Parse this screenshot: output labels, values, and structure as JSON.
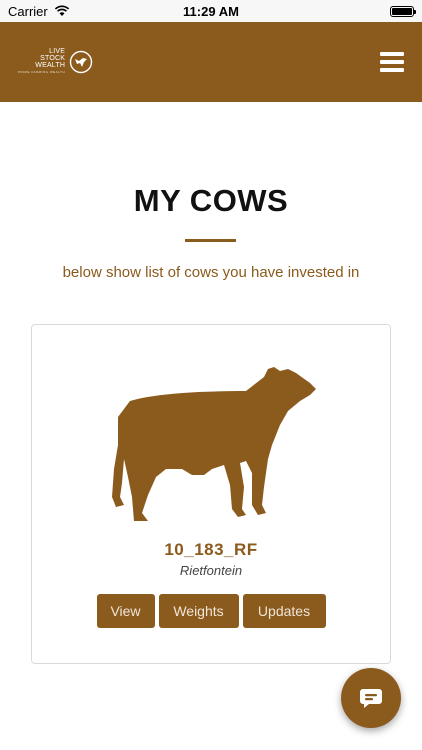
{
  "status_bar": {
    "carrier": "Carrier",
    "time": "11:29 AM"
  },
  "header": {
    "logo": {
      "line1": "LIVE",
      "line2": "STOCK",
      "line3": "WEALTH",
      "tagline": "PRIME FARMING WEALTH"
    },
    "menu_icon": "hamburger-menu-icon"
  },
  "page": {
    "title": "MY COWS",
    "subtitle": "below show list of cows you have invested in"
  },
  "cows": [
    {
      "id": "10_183_RF",
      "farm": "Rietfontein",
      "buttons": {
        "view": "View",
        "weights": "Weights",
        "updates": "Updates"
      }
    }
  ],
  "chat": {
    "icon": "chat-icon"
  },
  "colors": {
    "brand": "#8b5a1d",
    "card_border": "#d9d9d9",
    "background": "#ffffff"
  }
}
